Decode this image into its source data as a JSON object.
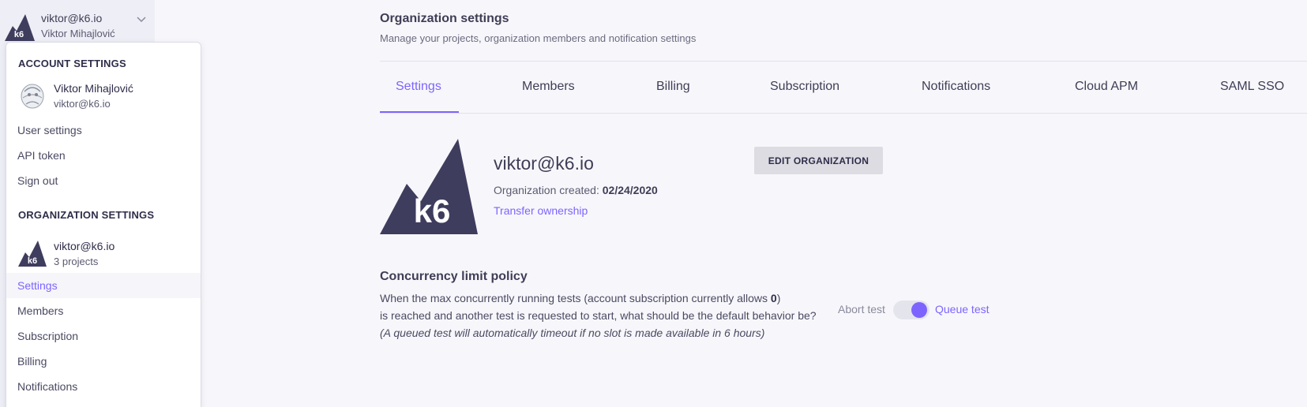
{
  "account_switcher": {
    "email": "viktor@k6.io",
    "name": "Viktor Mihajlović"
  },
  "menu": {
    "account_section": "ACCOUNT SETTINGS",
    "user": {
      "name": "Viktor Mihajlović",
      "email": "viktor@k6.io"
    },
    "account_items": [
      "User settings",
      "API token",
      "Sign out"
    ],
    "org_section": "ORGANIZATION SETTINGS",
    "org": {
      "name": "viktor@k6.io",
      "projects": "3 projects"
    },
    "org_items": [
      "Settings",
      "Members",
      "Subscription",
      "Billing",
      "Notifications"
    ],
    "active_org_item": "Settings"
  },
  "header": {
    "title": "Organization settings",
    "subtitle": "Manage your projects, organization members and notification settings"
  },
  "tabs": [
    "Settings",
    "Members",
    "Billing",
    "Subscription",
    "Notifications",
    "Cloud APM",
    "SAML SSO"
  ],
  "active_tab": "Settings",
  "organization": {
    "name": "viktor@k6.io",
    "created_label": "Organization created:",
    "created_date": "02/24/2020",
    "transfer_link": "Transfer ownership",
    "edit_button": "EDIT ORGANIZATION",
    "logo_text": "k6"
  },
  "concurrency": {
    "title": "Concurrency limit policy",
    "line1_prefix": "When the max concurrently running tests (account subscription currently allows ",
    "allowed": "0",
    "line1_suffix": ")",
    "line2": "is reached and another test is requested to start, what should be the default behavior be?",
    "note": "(A queued test will automatically timeout if no slot is made available in 6 hours)",
    "option_off": "Abort test",
    "option_on": "Queue test",
    "selected": "Queue test"
  },
  "colors": {
    "accent": "#7d64ff",
    "brand_dark": "#3f3d5e",
    "page_bg": "#f7f7fb"
  }
}
